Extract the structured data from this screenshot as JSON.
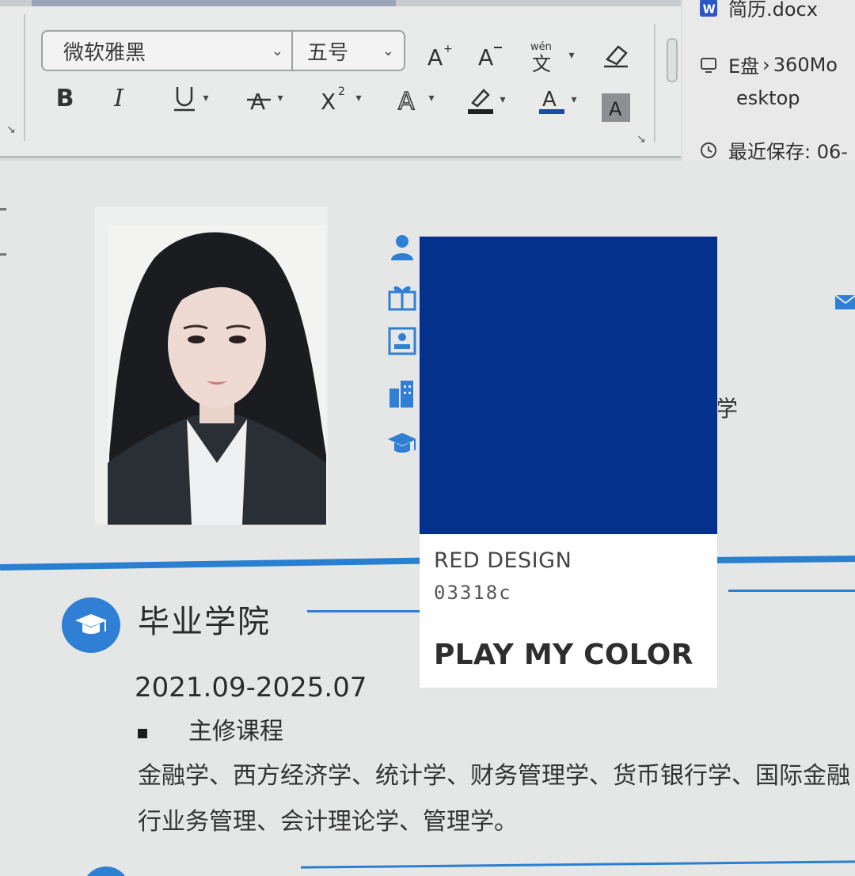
{
  "ribbon": {
    "font_name": "微软雅黑",
    "font_size": "五号",
    "tools_row1": [
      {
        "name": "grow-font",
        "label": "A⁺"
      },
      {
        "name": "shrink-font",
        "label": "A⁻"
      },
      {
        "name": "phonetic-guide",
        "label": "wén"
      },
      {
        "name": "clear-format",
        "label": "◇"
      }
    ],
    "tools_row2": [
      {
        "name": "bold",
        "label": "B"
      },
      {
        "name": "italic",
        "label": "I"
      },
      {
        "name": "underline",
        "label": "U"
      },
      {
        "name": "strikethrough",
        "label": "A"
      },
      {
        "name": "superscript",
        "label": "X²"
      },
      {
        "name": "text-effects",
        "label": "A"
      },
      {
        "name": "highlight",
        "label": "✎"
      },
      {
        "name": "font-color",
        "label": "A"
      },
      {
        "name": "char-shading",
        "label": "A"
      }
    ]
  },
  "side_pane": {
    "file_name": "简历.docx",
    "location_drive": "E盘",
    "location_sep": "›",
    "location_folder": "360Mo",
    "location_cont": "esktop",
    "recent_save": "最近保存: 06-"
  },
  "card": {
    "brand": "RED DESIGN",
    "code": "03318c",
    "slogan": "PLAY MY COLOR",
    "swatch_color": "#03318c"
  },
  "resume": {
    "partial_right_text": "学",
    "section_title": "毕业学院",
    "date_range": "2021.09-2025.07",
    "courses_heading": "主修课程",
    "course_line1": "金融学、西方经济学、统计学、财务管理学、货币银行学、国际金融",
    "course_line2": "行业务管理、会计理论学、管理学。"
  },
  "colors": {
    "accent_blue": "#2f7fd4",
    "swatch": "#03318c"
  }
}
